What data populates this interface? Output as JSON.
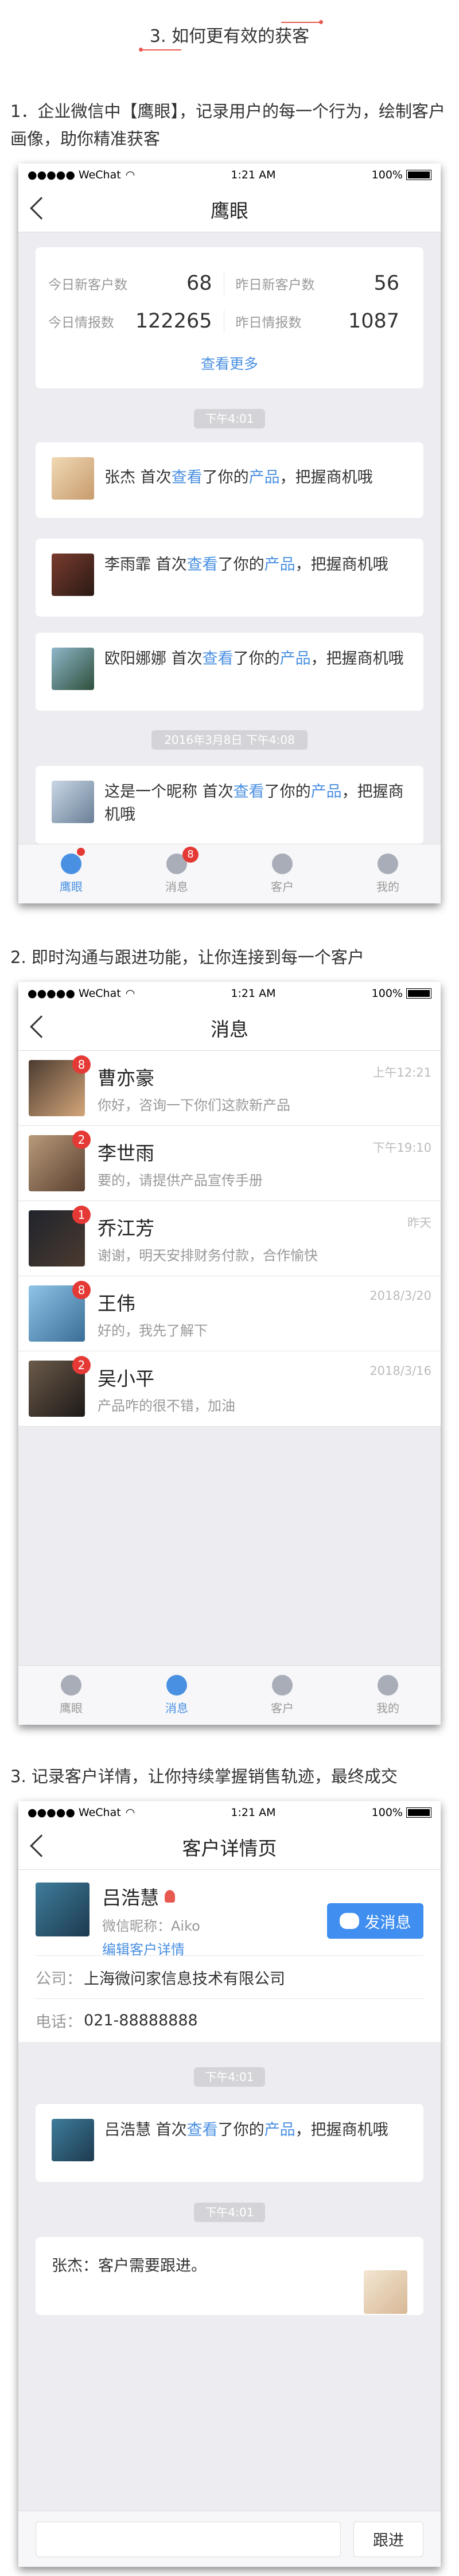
{
  "section_title": "3. 如何更有效的获客",
  "intro1": "1．企业微信中【鹰眼】，记录用户的每一个行为，绘制客户画像，助你精准获客",
  "intro2": "2. 即时沟通与跟进功能，让你连接到每一个客户",
  "intro3": "3. 记录客户详情，让你持续掌握销售轨迹，最终成交",
  "status": {
    "carrier": "●●●●● WeChat",
    "wifi_icon": "wifi-icon",
    "time": "1:21 AM",
    "battery": "100%"
  },
  "screen1": {
    "title": "鹰眼",
    "stats": [
      {
        "label": "今日新客户数",
        "value": "68"
      },
      {
        "label": "昨日新客户数",
        "value": "56"
      },
      {
        "label": "今日情报数",
        "value": "122265"
      },
      {
        "label": "昨日情报数",
        "value": "1087"
      }
    ],
    "more": "查看更多",
    "time1": "下午4:01",
    "time2": "2016年3月8日 下午4:08",
    "events": [
      {
        "name": "张杰",
        "pre": "首次",
        "view": "查看",
        "mid": "了你的",
        "product": "产品",
        "post": "，把握商机哦"
      },
      {
        "name": "李雨霏",
        "pre": "首次",
        "view": "查看",
        "mid": "了你的",
        "product": "产品",
        "post": "，把握商机哦"
      },
      {
        "name": "欧阳娜娜",
        "pre": "首次",
        "view": "查看",
        "mid": "了你的",
        "product": "产品",
        "post": "，把握商机哦"
      },
      {
        "name": "这是一个昵称",
        "pre": "首次",
        "view": "查看",
        "mid": "了你的",
        "product": "产品",
        "post": "，把握商机哦"
      }
    ]
  },
  "tabs": [
    {
      "label": "鹰眼",
      "icon": "eagle-eye-icon"
    },
    {
      "label": "消息",
      "icon": "message-icon",
      "badge": "8"
    },
    {
      "label": "客户",
      "icon": "customer-icon"
    },
    {
      "label": "我的",
      "icon": "profile-icon"
    }
  ],
  "screen2": {
    "title": "消息",
    "messages": [
      {
        "name": "曹亦豪",
        "preview": "你好，咨询一下你们这款新产品",
        "time": "上午12:21",
        "badge": "8"
      },
      {
        "name": "李世雨",
        "preview": "要的，请提供产品宣传手册",
        "time": "下午19:10",
        "badge": "2"
      },
      {
        "name": "乔江芳",
        "preview": "谢谢，明天安排财务付款，合作愉快",
        "time": "昨天",
        "badge": "1"
      },
      {
        "name": "王伟",
        "preview": "好的，我先了解下",
        "time": "2018/3/20",
        "badge": "8"
      },
      {
        "name": "吴小平",
        "preview": "产品咋的很不错，加油",
        "time": "2018/3/16",
        "badge": "2"
      }
    ]
  },
  "screen3": {
    "title": "客户详情页",
    "name": "吕浩慧",
    "nickname": "微信昵称：Aiko",
    "edit": "编辑客户详情",
    "send": "发消息",
    "company_label": "公司：",
    "company": "上海微问家信息技术有限公司",
    "phone_label": "电话：",
    "phone": "021-88888888",
    "time1": "下午4:01",
    "event": {
      "name": "吕浩慧",
      "pre": "首次",
      "view": "查看",
      "mid": "了你的",
      "product": "产品",
      "post": "，把握商机哦"
    },
    "time2": "下午4:01",
    "note": "张杰：客户需要跟进。",
    "follow": "跟进",
    "input_value": ""
  }
}
